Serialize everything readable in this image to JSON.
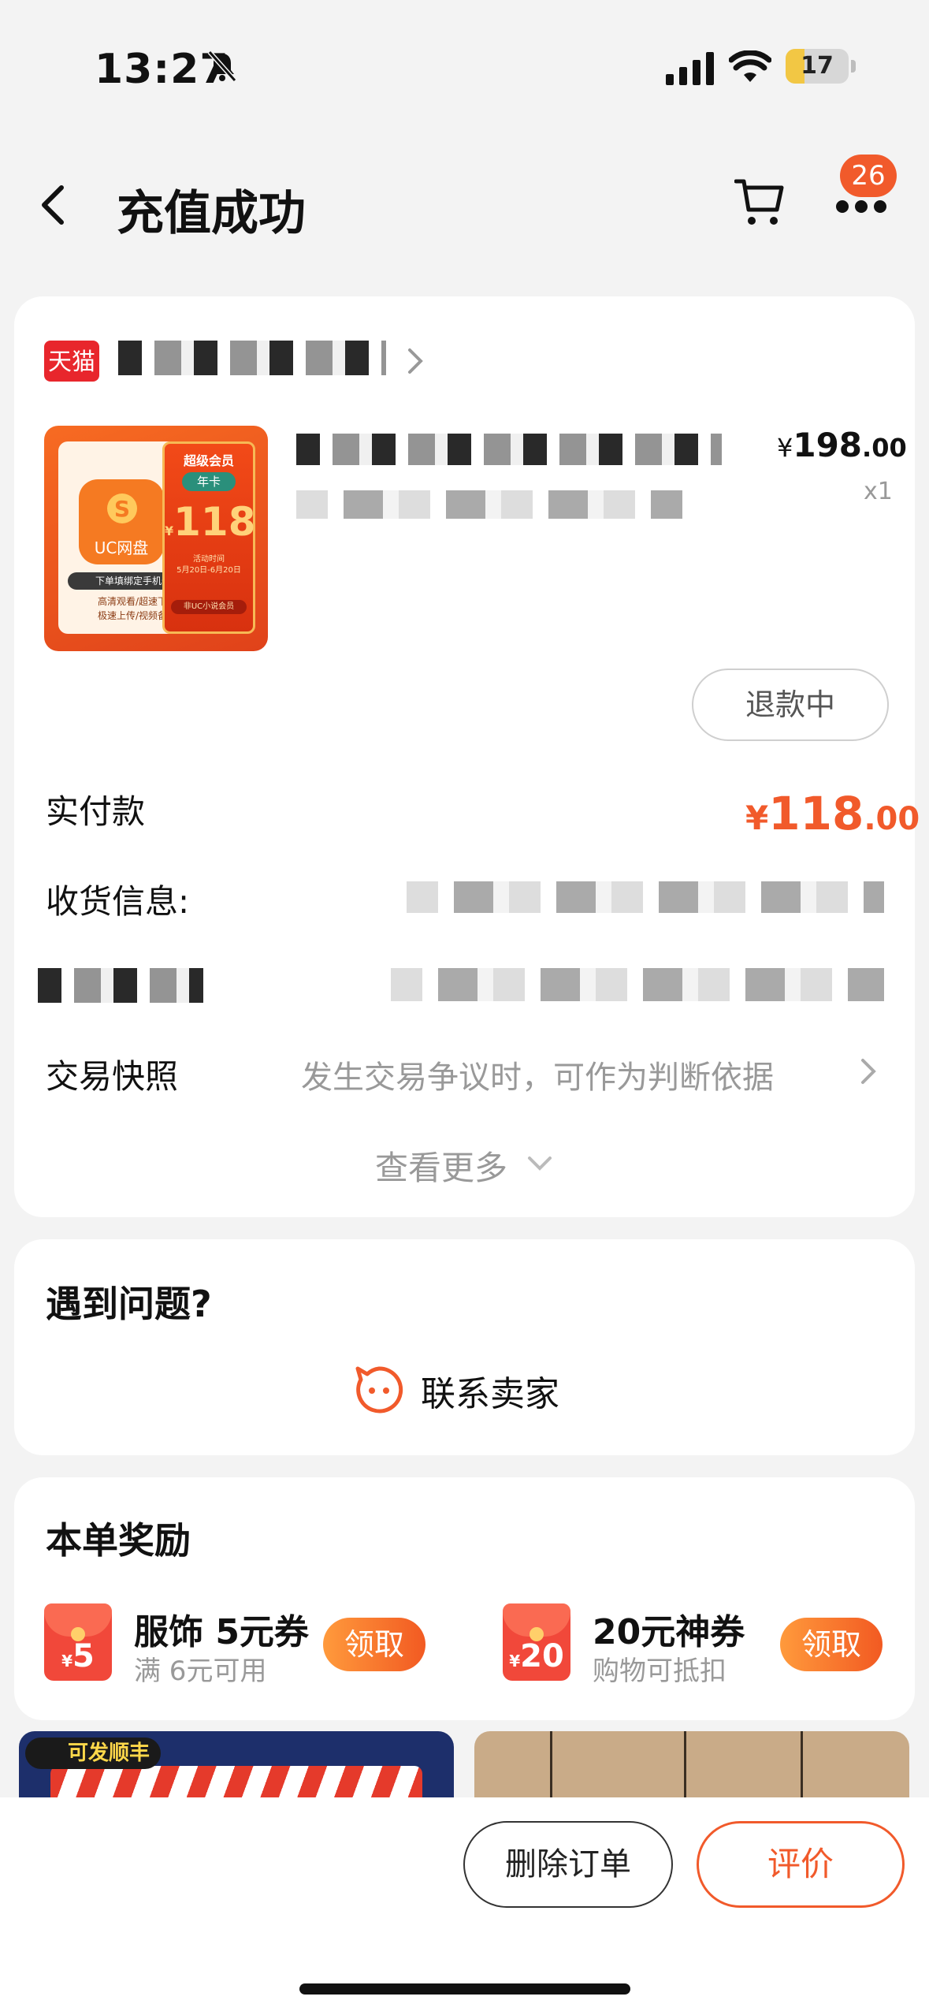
{
  "status_bar": {
    "time": "13:27",
    "battery": "17",
    "icons": [
      "bell-muted-icon",
      "signal-icon",
      "wifi-icon",
      "battery-icon"
    ]
  },
  "header": {
    "title": "充值成功",
    "badge": "26",
    "icons": [
      "back-icon",
      "cart-icon",
      "more-icon"
    ]
  },
  "order": {
    "store_brand": "天猫",
    "product_image": {
      "app_name": "UC网盘",
      "tag": "下单填绑定手机号",
      "desc_line1": "高清观看/超速下载",
      "desc_line2": "极速上传/视频备份",
      "badge_title": "超级会员",
      "badge_type": "年卡",
      "badge_price": "118",
      "badge_yen": "¥",
      "event_title": "活动时间",
      "event_dates": "5月20日-6月20日",
      "event_footer": "非UC小说会员"
    },
    "price_currency": "¥",
    "price_int": "198",
    "price_dec": ".00",
    "quantity": "x1",
    "refund_status": "退款中",
    "paid_label": "实付款",
    "paid_currency": "¥",
    "paid_int": "118",
    "paid_dec": ".00",
    "shipping_label": "收货信息:",
    "snapshot_label": "交易快照",
    "snapshot_hint": "发生交易争议时，可作为判断依据",
    "view_more": "查看更多"
  },
  "help": {
    "title": "遇到问题?",
    "contact_seller": "联系卖家"
  },
  "rewards": {
    "title": "本单奖励",
    "coupons": [
      {
        "icon_value": "5",
        "icon_yen": "¥",
        "title": "服饰 5元券",
        "subtitle": "满 6元可用",
        "action": "领取"
      },
      {
        "icon_value": "20",
        "icon_yen": "¥",
        "title": "20元神券",
        "subtitle": "购物可抵扣",
        "action": "领取"
      }
    ]
  },
  "promos": [
    {
      "tag": "可发顺丰"
    }
  ],
  "actions": {
    "delete": "删除订单",
    "rate": "评价"
  },
  "colors": {
    "accent": "#f15a2b",
    "tmall_red": "#e8262c",
    "background": "#f3f3f3"
  }
}
